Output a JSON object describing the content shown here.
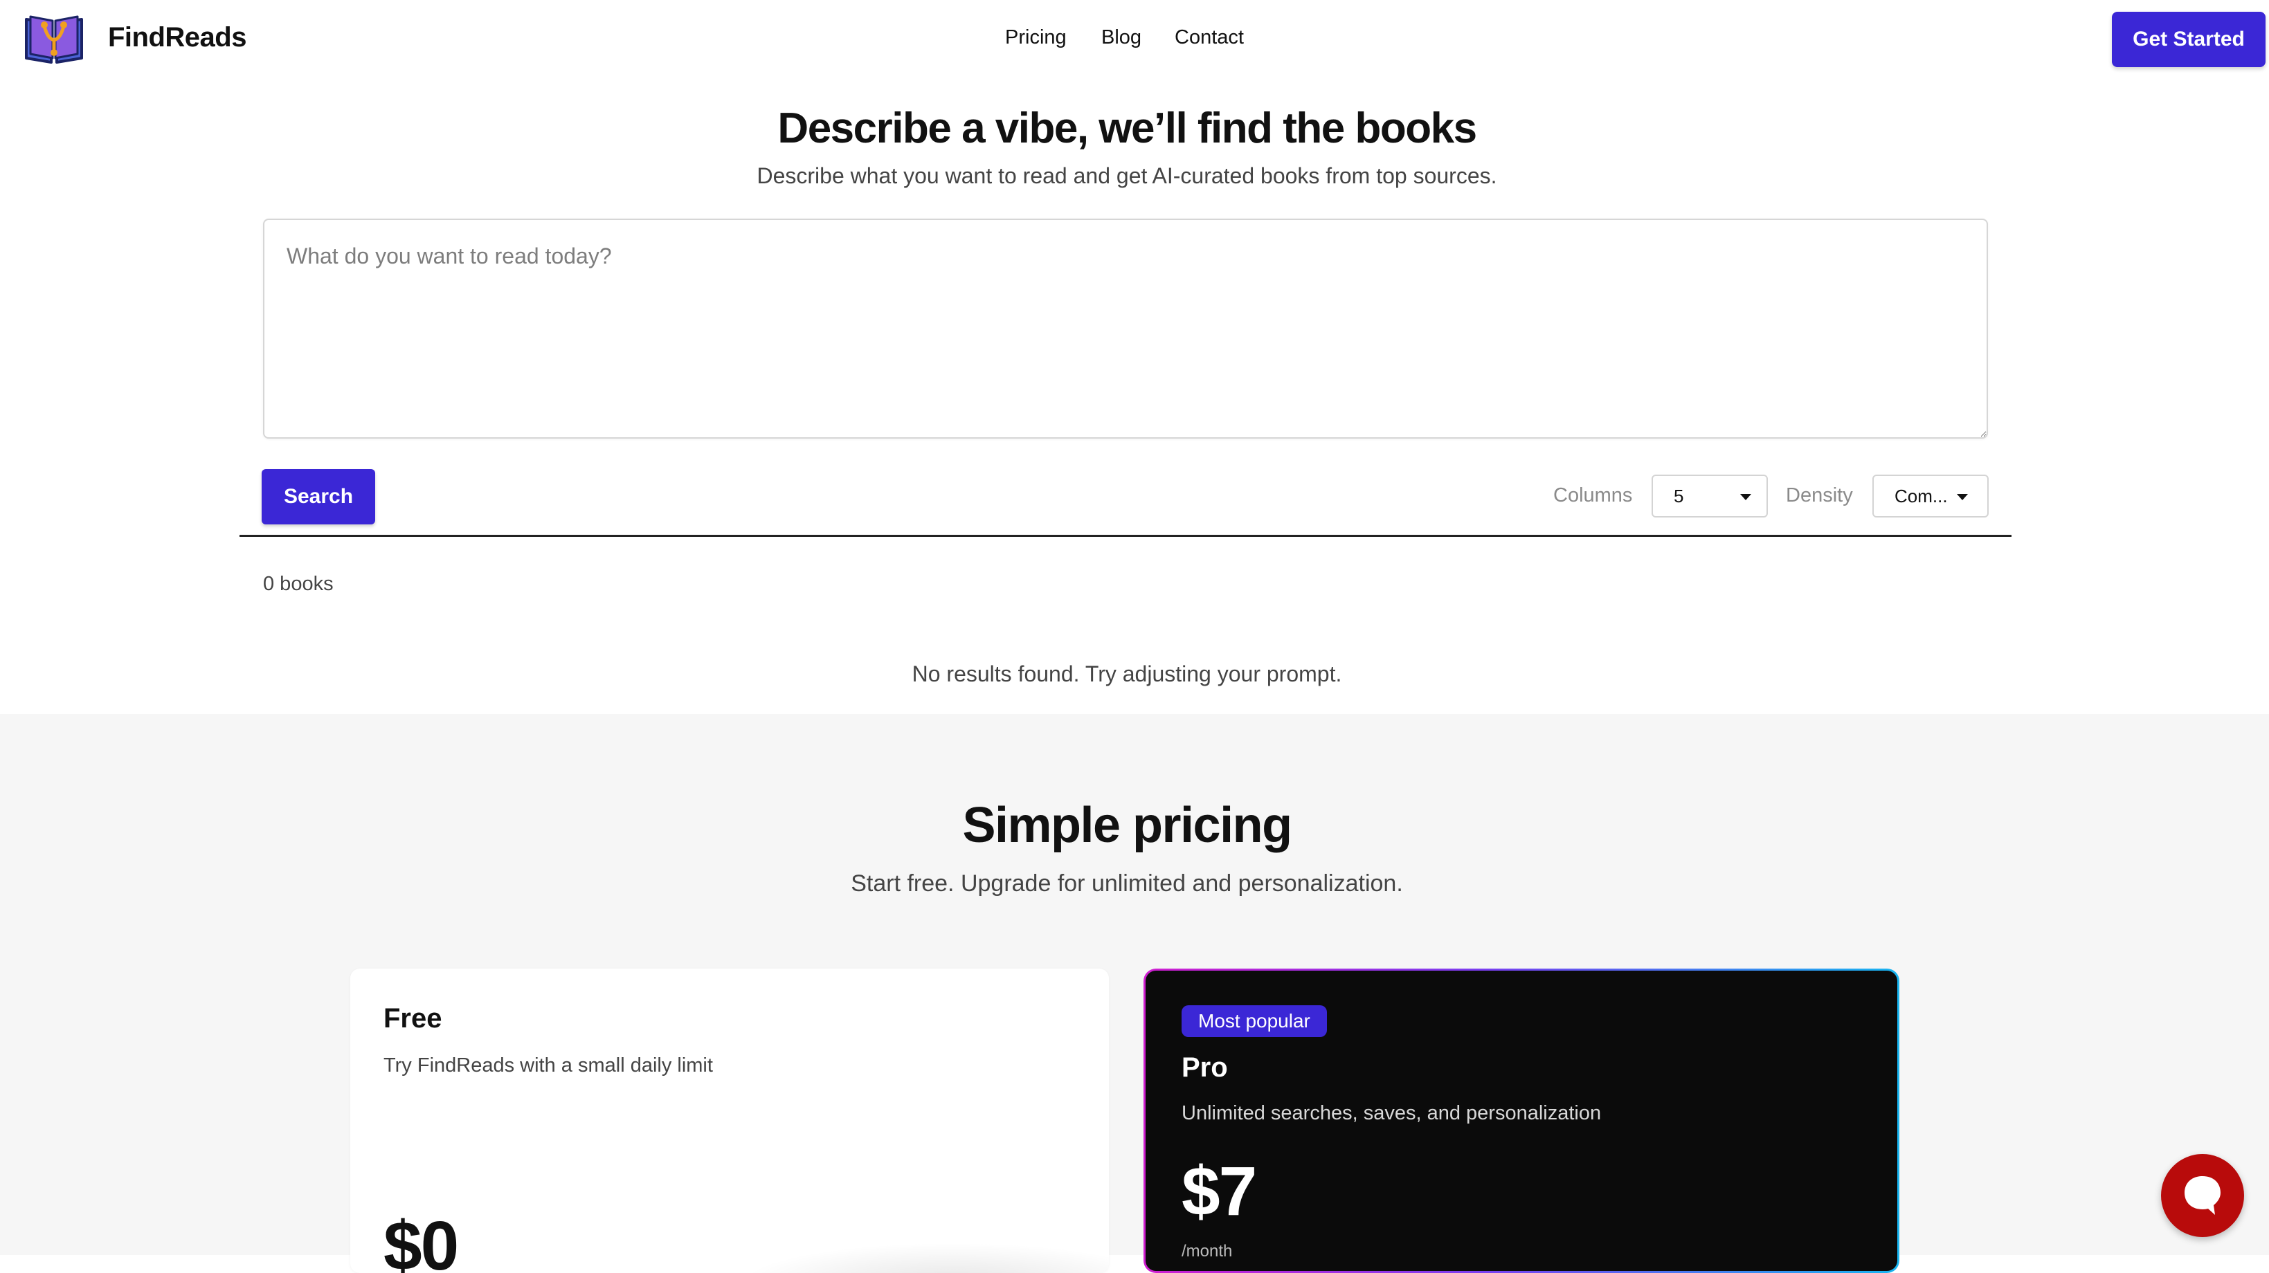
{
  "header": {
    "brand": "FindReads",
    "nav": [
      {
        "label": "Pricing"
      },
      {
        "label": "Blog"
      },
      {
        "label": "Contact"
      }
    ],
    "cta_label": "Get Started",
    "logo_icon": "book-logo-icon"
  },
  "hero": {
    "title": "Describe a vibe, we’ll find the books",
    "subtitle": "Describe what you want to read and get AI-curated books from top sources.",
    "prompt_placeholder": "What do you want to read today?",
    "prompt_value": "",
    "search_label": "Search",
    "columns_label": "Columns",
    "columns_value": "5",
    "density_label": "Density",
    "density_value": "Com...",
    "result_count": "0 books",
    "no_results": "No results found. Try adjusting your prompt."
  },
  "pricing": {
    "title": "Simple pricing",
    "subtitle": "Start free. Upgrade for unlimited and personalization.",
    "plans": [
      {
        "name": "Free",
        "description": "Try FindReads with a small daily limit",
        "price": "$0"
      },
      {
        "badge": "Most popular",
        "name": "Pro",
        "description": "Unlimited searches, saves, and personalization",
        "price": "$7",
        "period": "/month"
      }
    ]
  },
  "chat": {
    "icon": "chat-bubble-icon"
  },
  "colors": {
    "accent": "#3b27d6",
    "chat": "#b80b0b",
    "pro_card_bg": "#0b0b0b",
    "pricing_bg": "#f6f6f6"
  }
}
